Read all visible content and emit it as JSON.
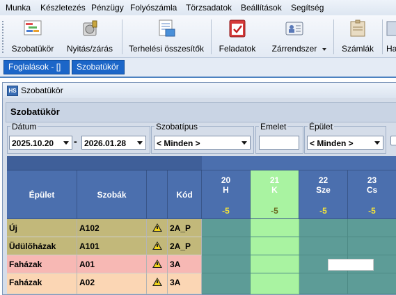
{
  "menu": [
    "Munka",
    "Készletezés",
    "Pénzügy",
    "Folyószámla",
    "Törzsadatok",
    "Beállítások",
    "Segítség"
  ],
  "toolbar": {
    "items": [
      {
        "label": "Szobatükör",
        "icon": "room-mirror-icon"
      },
      {
        "label": "Nyitás/zárás",
        "icon": "open-close-icon"
      },
      {
        "label": "Terhelési összesítők",
        "icon": "charge-summary-icon"
      },
      {
        "label": "Feladatok",
        "icon": "tasks-icon"
      },
      {
        "label": "Zárrendszer",
        "icon": "lock-system-icon"
      },
      {
        "label": "Számlák",
        "icon": "invoices-icon"
      },
      {
        "label": "Ha",
        "icon": "more-icon"
      }
    ]
  },
  "tabs": [
    {
      "label": "Foglalások - []"
    },
    {
      "label": "Szobatükör"
    }
  ],
  "window": {
    "title": "Szobatükör",
    "header": "Szobatükör"
  },
  "filters": {
    "datum_label": "Dátum",
    "date_from": "2025.10.20",
    "date_to": "2026.01.28",
    "dash": "-",
    "szobatipus_label": "Szobatípus",
    "szobatipus_value": "< Minden >",
    "emelet_label": "Emelet",
    "emelet_value": "",
    "epulet_label": "Épület",
    "epulet_value": "< Minden >"
  },
  "grid": {
    "columns": {
      "building": "Épület",
      "rooms": "Szobák",
      "code": "Kód"
    },
    "days": [
      {
        "num": "20",
        "dow": "H",
        "val": "-5",
        "selected": false
      },
      {
        "num": "21",
        "dow": "K",
        "val": "-5",
        "selected": true
      },
      {
        "num": "22",
        "dow": "Sze",
        "val": "-5",
        "selected": false
      },
      {
        "num": "23",
        "dow": "Cs",
        "val": "-5",
        "selected": false
      }
    ],
    "rows": [
      {
        "building": "Új",
        "room": "A102",
        "code": "2A_P",
        "color": "#c2b87a"
      },
      {
        "building": "Üdülőházak",
        "room": "A101",
        "code": "2A_P",
        "color": "#c2b87a"
      },
      {
        "building": "Faházak",
        "room": "A01",
        "code": "3A",
        "color": "#f7b8b4"
      },
      {
        "building": "Faházak",
        "room": "A02",
        "code": "3A",
        "color": "#fbd6b4"
      }
    ]
  }
}
